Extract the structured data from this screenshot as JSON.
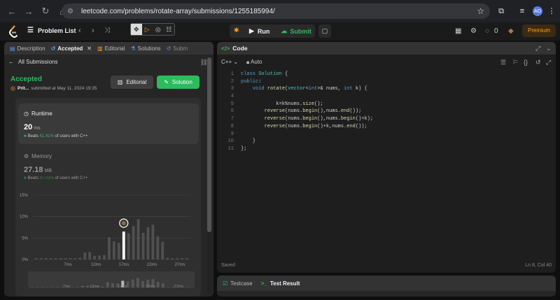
{
  "browser": {
    "url": "leetcode.com/problems/rotate-array/submissions/1255185994/",
    "profile_initials": "AO"
  },
  "topbar": {
    "problem_list": "Problem List",
    "run": "Run",
    "submit": "Submit",
    "coins": "0",
    "premium": "Premium"
  },
  "left_tabs": [
    {
      "label": "Description"
    },
    {
      "label": "Accepted"
    },
    {
      "label": "Editorial"
    },
    {
      "label": "Solutions"
    },
    {
      "label": "Subm"
    }
  ],
  "submission": {
    "back_label": "All Submissions",
    "status": "Accepted",
    "user": "Prit...",
    "submitted": "submitted at May 11, 2024 19:35",
    "editorial_button": "Editorial",
    "solution_button": "Solution"
  },
  "runtime": {
    "title": "Runtime",
    "value": "20",
    "unit": "ms",
    "beats_prefix": "Beats",
    "beats_pct": "61.41%",
    "beats_suffix": "of users with C++"
  },
  "memory": {
    "title": "Memory",
    "value": "27.18",
    "unit": "MB",
    "beats_prefix": "Beats",
    "beats_pct": "97.03%",
    "beats_suffix": "of users with C++"
  },
  "chart_data": {
    "type": "bar",
    "yticks": [
      "15%",
      "10%",
      "5%",
      "0%"
    ],
    "ylim": [
      0,
      15
    ],
    "xticks": [
      "7ms",
      "12ms",
      "17ms",
      "22ms",
      "27ms"
    ],
    "values": [
      0.3,
      0.3,
      0.3,
      0.3,
      0.3,
      0.3,
      0.3,
      0.3,
      0.3,
      0.4,
      1.6,
      1.7,
      0.8,
      0.9,
      1.0,
      5.2,
      4.2,
      3.9,
      6.5,
      6.1,
      7.8,
      9.4,
      6.2,
      7.5,
      8.1,
      5.4,
      4.1,
      0.4,
      0.3,
      0.3,
      0.3,
      0.3
    ],
    "highlight_index": 18,
    "mini_xticks": [
      "7ms",
      "12ms",
      "17ms",
      "22ms",
      "27ms"
    ],
    "grid": true
  },
  "editor": {
    "panel_title": "Code",
    "language": "C++",
    "mode": "Auto",
    "status_left": "Saved",
    "status_right": "Ln 8, Col 40",
    "lines": [
      "class Solution {",
      "public:",
      "    void rotate(vector<int>& nums, int k) {",
      "        ",
      "            k=k%nums.size();",
      "        reverse(nums.begin(),nums.end());",
      "        reverse(nums.begin(),nums.begin()+k);",
      "        reverse(nums.begin()+k,nums.end());",
      "        ",
      "    }",
      "};"
    ]
  },
  "bottom_tabs": [
    {
      "label": "Testcase"
    },
    {
      "label": "Test Result"
    }
  ]
}
